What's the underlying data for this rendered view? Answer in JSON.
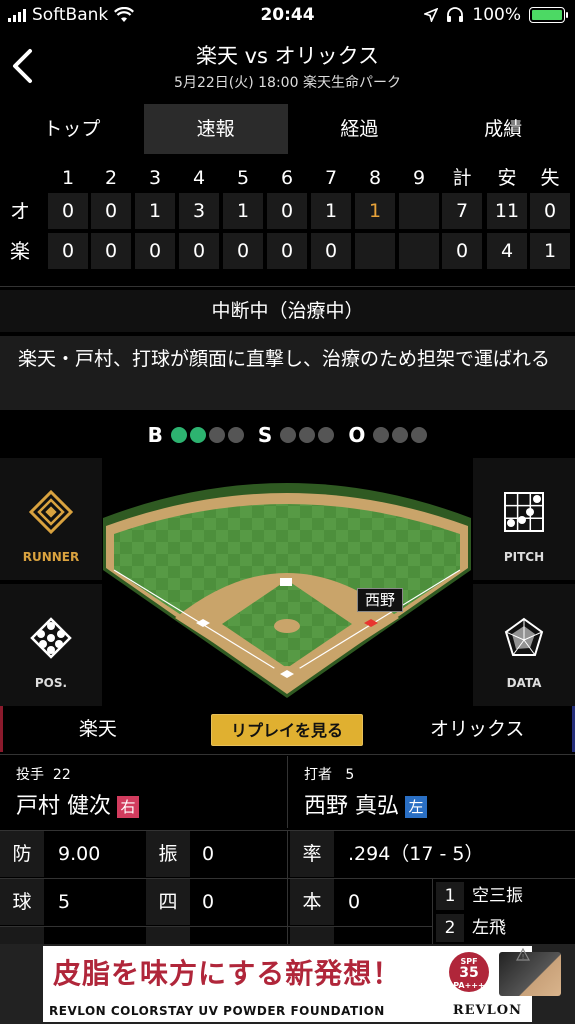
{
  "status_bar": {
    "carrier": "SoftBank",
    "time": "20:44",
    "battery": "100%"
  },
  "header": {
    "title": "楽天 vs オリックス",
    "subtitle": "5月22日(火) 18:00 楽天生命パーク"
  },
  "tabs": [
    {
      "label": "トップ",
      "active": false
    },
    {
      "label": "速報",
      "active": true
    },
    {
      "label": "経過",
      "active": false
    },
    {
      "label": "成績",
      "active": false
    }
  ],
  "scoreboard": {
    "innings": [
      "1",
      "2",
      "3",
      "4",
      "5",
      "6",
      "7",
      "8",
      "9",
      "計",
      "安",
      "失"
    ],
    "rows": [
      {
        "team": "オ",
        "cells": [
          "0",
          "0",
          "1",
          "3",
          "1",
          "0",
          "1",
          "1",
          "",
          "7",
          "11",
          "0"
        ]
      },
      {
        "team": "楽",
        "cells": [
          "0",
          "0",
          "0",
          "0",
          "0",
          "0",
          "0",
          "",
          "",
          "0",
          "4",
          "1"
        ]
      }
    ],
    "highlight_color": "#e8a33a"
  },
  "interrupt": "中断中（治療中）",
  "news": "楽天・戸村、打球が顔面に直撃し、治療のため担架で運ばれる",
  "count": {
    "balls_label": "B",
    "balls": 2,
    "balls_max": 4,
    "strikes_label": "S",
    "strikes": 0,
    "strikes_max": 3,
    "outs_label": "O",
    "outs": 0,
    "outs_max": 3
  },
  "field": {
    "runner_label": "RUNNER",
    "pitch_label": "PITCH",
    "pos_label": "POS.",
    "data_label": "DATA",
    "batter_tag": "西野"
  },
  "teambar": {
    "home": "楽天",
    "replay": "リプレイを見る",
    "away": "オリックス"
  },
  "pitcher": {
    "role": "投手",
    "number": "22",
    "name": "戸村 健次",
    "hand": "右"
  },
  "batter": {
    "role": "打者",
    "number": "5",
    "name": "西野 真弘",
    "hand": "左"
  },
  "pitcher_stats": [
    {
      "k1": "防",
      "v1": "9.00",
      "k2": "振",
      "v2": "0"
    },
    {
      "k1": "球",
      "v1": "5",
      "k2": "四",
      "v2": "0"
    }
  ],
  "batter_stats": [
    {
      "k": "率",
      "v": ".294（17 - 5）"
    },
    {
      "k": "本",
      "v": "0"
    }
  ],
  "at_bats": [
    {
      "n": "1",
      "result": "空三振"
    },
    {
      "n": "2",
      "result": "左飛"
    }
  ],
  "ad": {
    "headline": "皮脂を味方にする新発想！",
    "spf_top": "SPF",
    "spf_value": "35",
    "spf_pa": "PA+++",
    "product": "REVLON COLORSTAY UV POWDER FOUNDATION",
    "brand": "REVLON"
  }
}
